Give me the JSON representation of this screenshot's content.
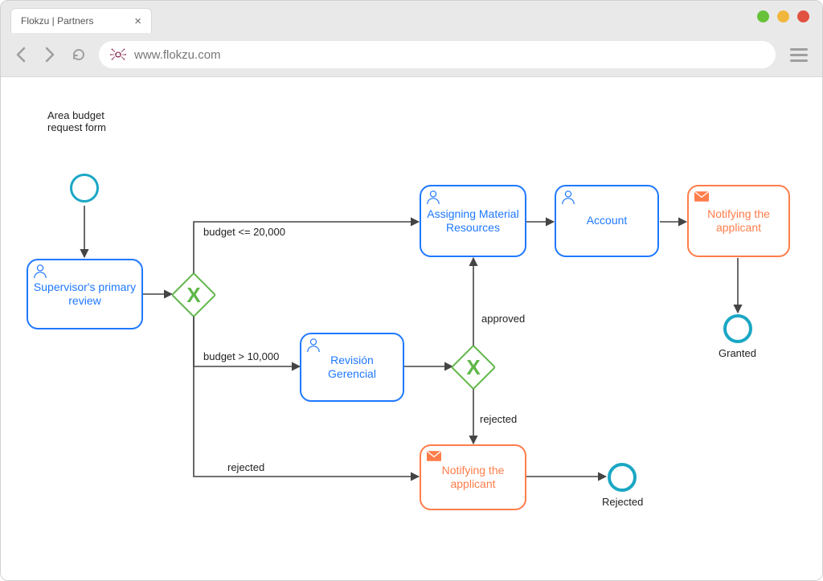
{
  "browser": {
    "tab_title": "Flokzu | Partners",
    "url": "www.flokzu.com"
  },
  "diagram": {
    "start_label": "Area budget\nrequest form",
    "tasks": {
      "supervisor": "Supervisor's primary review",
      "revision": "Revisión Gerencial",
      "assigning": "Assigning Material Resources",
      "account": "Account",
      "notify_top": "Notifying the applicant",
      "notify_bottom": "Notifying the applicant"
    },
    "edge_labels": {
      "budget_le": "budget <= 20,000",
      "budget_gt": "budget > 10,000",
      "approved": "approved",
      "rejected_top": "rejected",
      "rejected_bottom": "rejected"
    },
    "end_labels": {
      "granted": "Granted",
      "rejected": "Rejected"
    }
  },
  "chart_data": {
    "type": "bpmn-flowchart",
    "start_event": {
      "id": "start",
      "label": "Area budget request form"
    },
    "end_events": [
      {
        "id": "end_granted",
        "label": "Granted"
      },
      {
        "id": "end_rejected",
        "label": "Rejected"
      }
    ],
    "tasks": [
      {
        "id": "t_supervisor",
        "type": "user",
        "label": "Supervisor's primary review"
      },
      {
        "id": "t_revision",
        "type": "user",
        "label": "Revisión Gerencial"
      },
      {
        "id": "t_assigning",
        "type": "user",
        "label": "Assigning Material Resources"
      },
      {
        "id": "t_account",
        "type": "user",
        "label": "Account"
      },
      {
        "id": "t_notify_granted",
        "type": "message",
        "label": "Notifying the applicant"
      },
      {
        "id": "t_notify_rejected",
        "type": "message",
        "label": "Notifying the applicant"
      }
    ],
    "gateways": [
      {
        "id": "g1",
        "type": "exclusive"
      },
      {
        "id": "g2",
        "type": "exclusive"
      }
    ],
    "flows": [
      {
        "from": "start",
        "to": "t_supervisor"
      },
      {
        "from": "t_supervisor",
        "to": "g1"
      },
      {
        "from": "g1",
        "to": "t_assigning",
        "condition": "budget <= 20,000"
      },
      {
        "from": "g1",
        "to": "t_revision",
        "condition": "budget > 10,000"
      },
      {
        "from": "g1",
        "to": "t_notify_rejected",
        "condition": "rejected"
      },
      {
        "from": "t_revision",
        "to": "g2"
      },
      {
        "from": "g2",
        "to": "t_assigning",
        "condition": "approved"
      },
      {
        "from": "g2",
        "to": "t_notify_rejected",
        "condition": "rejected"
      },
      {
        "from": "t_assigning",
        "to": "t_account"
      },
      {
        "from": "t_account",
        "to": "t_notify_granted"
      },
      {
        "from": "t_notify_granted",
        "to": "end_granted"
      },
      {
        "from": "t_notify_rejected",
        "to": "end_rejected"
      }
    ]
  }
}
